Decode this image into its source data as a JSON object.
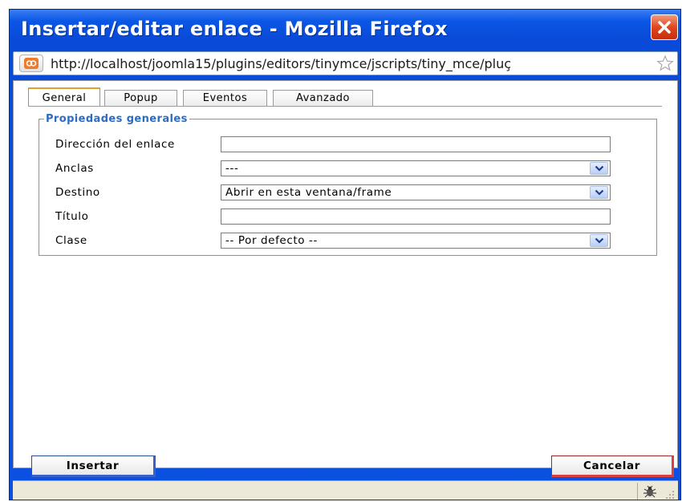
{
  "window": {
    "title": "Insertar/editar enlace - Mozilla Firefox",
    "close_icon": "close-icon",
    "accent": "#0b57e6"
  },
  "urlbar": {
    "url": "http://localhost/joomla15/plugins/editors/tinymce/jscripts/tiny_mce/pluç",
    "site_icon": "site-identity-icon",
    "star_icon": "bookmark-star-icon"
  },
  "tabs": [
    {
      "label": "General",
      "active": true
    },
    {
      "label": "Popup",
      "active": false
    },
    {
      "label": "Eventos",
      "active": false
    },
    {
      "label": "Avanzado",
      "active": false
    }
  ],
  "fieldset": {
    "legend": "Propiedades generales",
    "legend_color": "#2b6cc4"
  },
  "form": {
    "link_address": {
      "label": "Dirección del enlace",
      "value": ""
    },
    "anchors": {
      "label": "Anclas",
      "value": "---"
    },
    "target": {
      "label": "Destino",
      "value": "Abrir en esta ventana/frame"
    },
    "title": {
      "label": "Título",
      "value": ""
    },
    "class": {
      "label": "Clase",
      "value": "-- Por defecto --"
    }
  },
  "buttons": {
    "insert": "Insertar",
    "cancel": "Cancelar"
  },
  "statusbar": {
    "bug_icon": "firebug-icon",
    "grip_icon": "resize-grip-icon"
  }
}
